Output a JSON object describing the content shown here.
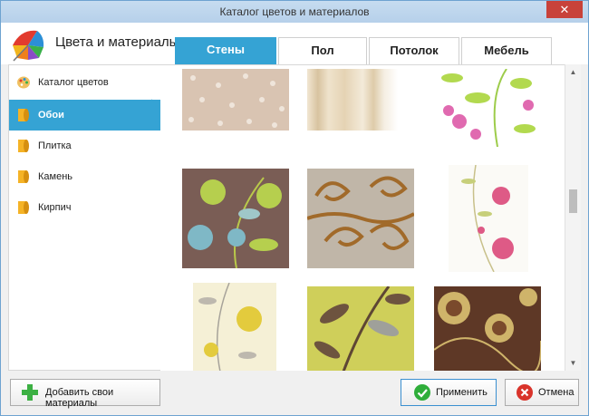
{
  "window": {
    "title": "Каталог цветов и материалов",
    "close_label": "✕"
  },
  "header": {
    "title": "Цвета и материалы"
  },
  "tabs": [
    {
      "label": "Стены",
      "active": true
    },
    {
      "label": "Пол",
      "active": false
    },
    {
      "label": "Потолок",
      "active": false
    },
    {
      "label": "Мебель",
      "active": false
    }
  ],
  "sidebar": {
    "items": [
      {
        "label": "Каталог цветов",
        "icon": "palette-icon",
        "active": false
      },
      {
        "label": "Обои",
        "icon": "wallpaper-roll-icon",
        "active": true
      },
      {
        "label": "Плитка",
        "icon": "wallpaper-roll-icon",
        "active": false
      },
      {
        "label": "Камень",
        "icon": "wallpaper-roll-icon",
        "active": false
      },
      {
        "label": "Кирпич",
        "icon": "wallpaper-roll-icon",
        "active": false
      }
    ]
  },
  "scrollbar": {
    "up": "▲",
    "down": "▼"
  },
  "footer": {
    "add_label": "Добавить свои материалы",
    "apply_label": "Применить",
    "cancel_label": "Отмена"
  },
  "colors": {
    "accent": "#35a3d4",
    "add_icon": "#3cb043",
    "apply_icon": "#2fae3a",
    "cancel_icon": "#d9342b"
  }
}
